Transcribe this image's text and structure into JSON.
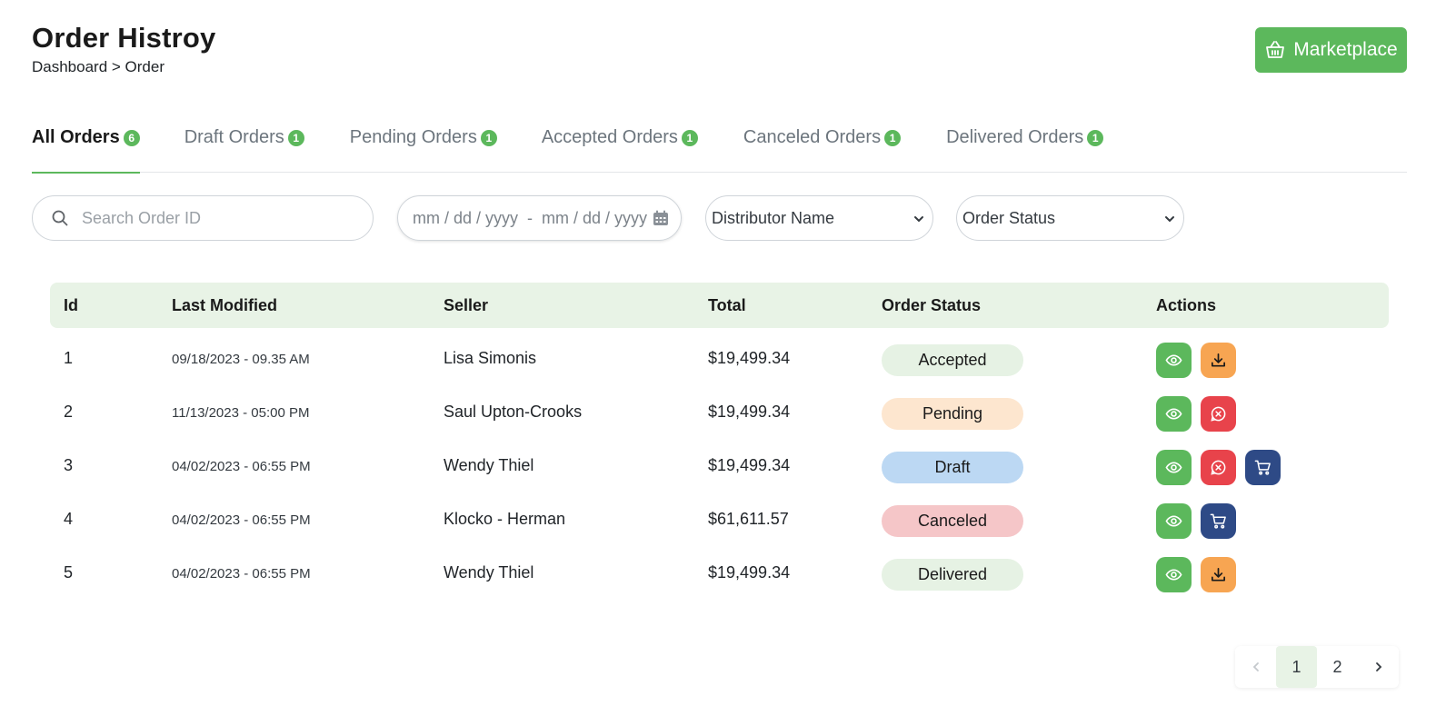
{
  "header": {
    "title": "Order Histroy",
    "breadcrumb": "Dashboard > Order"
  },
  "marketplace_button": {
    "label": "Marketplace",
    "icon": "basket-icon"
  },
  "tabs": [
    {
      "label": "All Orders",
      "count": "6",
      "active": true
    },
    {
      "label": "Draft Orders",
      "count": "1"
    },
    {
      "label": "Pending Orders",
      "count": "1"
    },
    {
      "label": "Accepted Orders",
      "count": "1"
    },
    {
      "label": "Canceled Orders",
      "count": "1"
    },
    {
      "label": "Delivered Orders",
      "count": "1"
    }
  ],
  "filters": {
    "search_placeholder": "Search Order ID",
    "date_range_placeholder": "mm / dd / yyyy  -  mm / dd / yyyy",
    "distributor_select": "Distributor Name",
    "status_select": "Order Status"
  },
  "table": {
    "columns": [
      "Id",
      "Last Modified",
      "Seller",
      "Total",
      "Order Status",
      "Actions"
    ],
    "rows": [
      {
        "id": "1",
        "modified": "09/18/2023 - 09.35 AM",
        "seller": "Lisa Simonis",
        "total": "$19,499.34",
        "status": "Accepted",
        "actions": [
          "view",
          "download"
        ]
      },
      {
        "id": "2",
        "modified": "11/13/2023 - 05:00 PM",
        "seller": "Saul Upton-Crooks",
        "total": "$19,499.34",
        "status": "Pending",
        "actions": [
          "view",
          "cancel"
        ]
      },
      {
        "id": "3",
        "modified": "04/02/2023 - 06:55 PM",
        "seller": "Wendy Thiel",
        "total": "$19,499.34",
        "status": "Draft",
        "actions": [
          "view",
          "cancel",
          "cart"
        ]
      },
      {
        "id": "4",
        "modified": "04/02/2023 - 06:55 PM",
        "seller": "Klocko - Herman",
        "total": "$61,611.57",
        "status": "Canceled",
        "actions": [
          "view",
          "cart"
        ]
      },
      {
        "id": "5",
        "modified": "04/02/2023 - 06:55 PM",
        "seller": "Wendy Thiel",
        "total": "$19,499.34",
        "status": "Delivered",
        "actions": [
          "view",
          "download"
        ]
      }
    ]
  },
  "status_colors": {
    "Accepted": "#e6f2e4",
    "Pending": "#fde6cf",
    "Draft": "#bcd8f3",
    "Canceled": "#f5c6c8",
    "Delivered": "#e6f2e4"
  },
  "pagination": {
    "pages": [
      "1",
      "2"
    ],
    "current": "1"
  },
  "colors": {
    "accent": "#5cb85c",
    "download": "#f7a552",
    "cancel": "#e8434b",
    "cart": "#2e4a86"
  }
}
